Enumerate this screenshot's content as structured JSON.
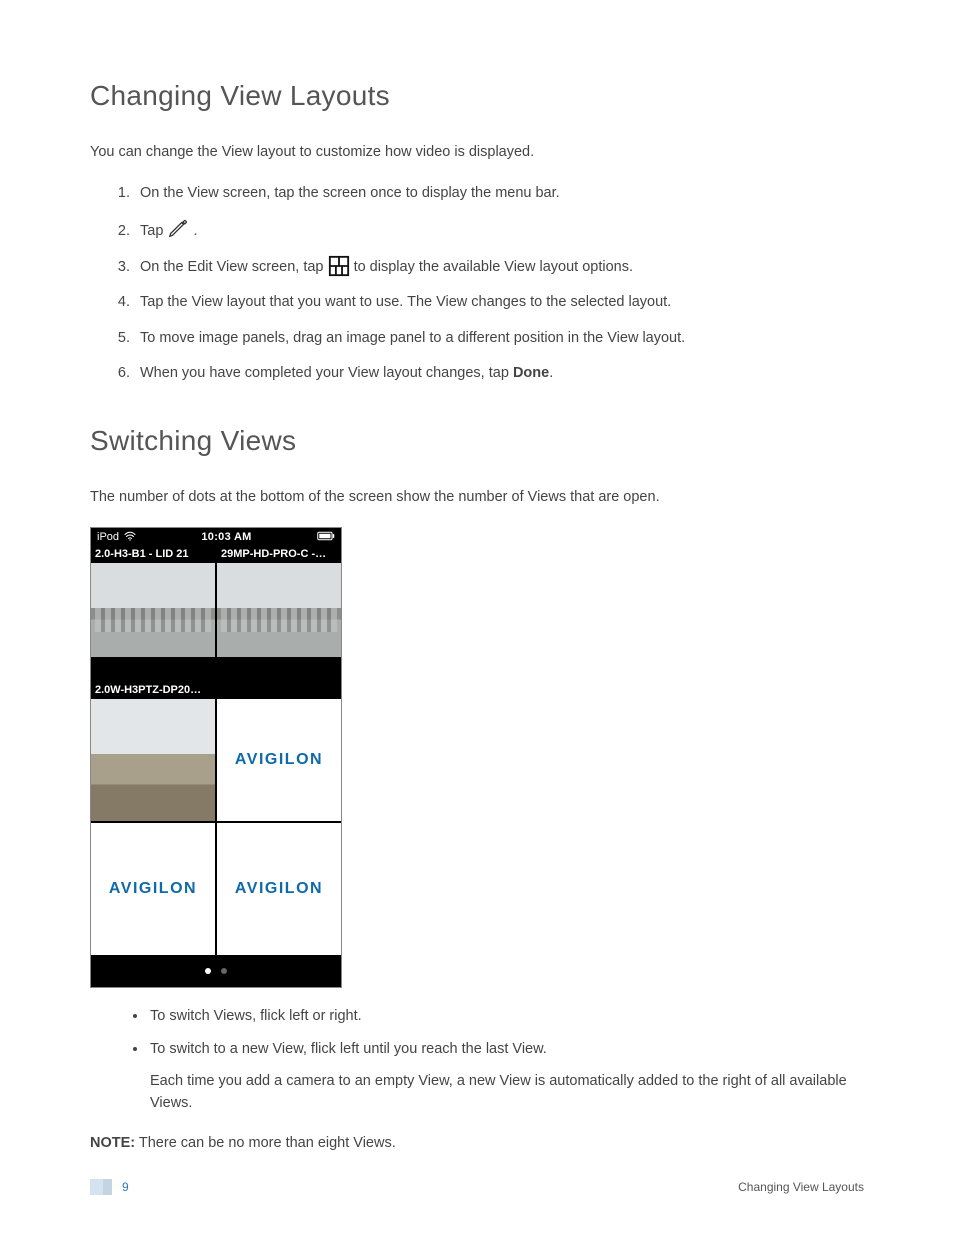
{
  "section1": {
    "heading": "Changing View Layouts",
    "intro": "You can change the View layout to customize how video is displayed.",
    "steps": {
      "s1": "On the View screen, tap the screen once to display the menu bar.",
      "s2_pre": "Tap ",
      "s2_post": " .",
      "s3_pre": "On the Edit View screen, tap ",
      "s3_post": " to display the available View layout options.",
      "s4": "Tap the View layout that you want to use. The View changes to the selected layout.",
      "s5": "To move image panels, drag an image panel to a different position in the View layout.",
      "s6_pre": "When you have completed your View layout changes, tap ",
      "s6_bold": "Done",
      "s6_post": "."
    }
  },
  "section2": {
    "heading": "Switching Views",
    "intro": "The number of dots at the bottom of the screen show the number of Views that are open.",
    "bullets": {
      "b1": "To switch Views, flick left or right.",
      "b2": "To switch to a new View, flick left until you reach the last View.",
      "b2_sub": "Each time you add a camera to an empty View, a new View is automatically added to the right of all available Views."
    },
    "note_label": "NOTE:",
    "note_text": " There can be no more than eight Views."
  },
  "device": {
    "status_left": "iPod",
    "status_time": "10:03 AM",
    "cam1": "2.0-H3-B1 - LID 21",
    "cam2": "29MP-HD-PRO-C -…",
    "cam3": "2.0W-H3PTZ-DP20…",
    "logo": "AVIGILON"
  },
  "footer": {
    "page_number": "9",
    "title": "Changing View Layouts"
  }
}
